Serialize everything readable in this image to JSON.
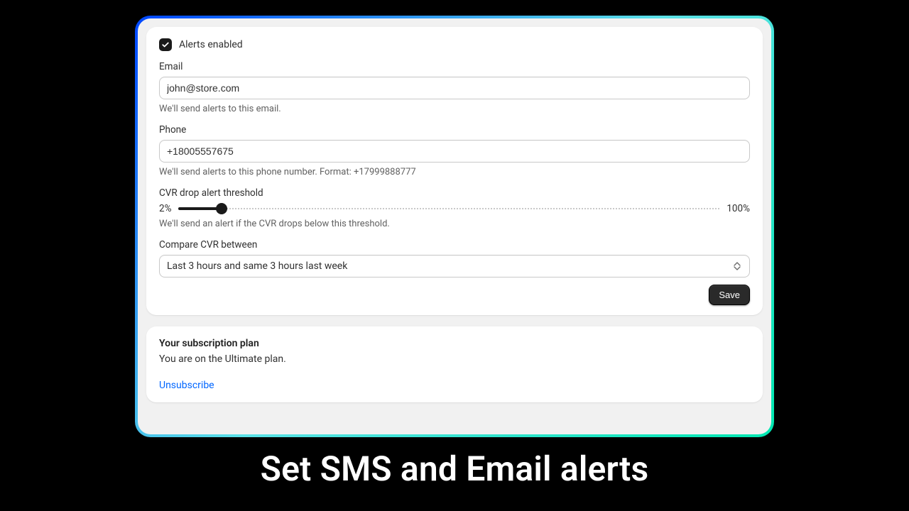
{
  "alerts_enabled_label": "Alerts enabled",
  "email": {
    "label": "Email",
    "value": "john@store.com",
    "help": "We'll send alerts to this email."
  },
  "phone": {
    "label": "Phone",
    "value": "+18005557675",
    "help": "We'll send alerts to this phone number. Format: +17999888777"
  },
  "threshold": {
    "label": "CVR drop alert threshold",
    "min_label": "2%",
    "max_label": "100%",
    "value_pct": 8,
    "help": "We'll send an alert if the CVR drops below this threshold."
  },
  "compare": {
    "label": "Compare CVR between",
    "selected": "Last 3 hours and same 3 hours last week"
  },
  "save_label": "Save",
  "subscription": {
    "title": "Your subscription plan",
    "text": "You are on the Ultimate plan.",
    "unsubscribe": "Unsubscribe"
  },
  "hero": "Set SMS and Email alerts"
}
